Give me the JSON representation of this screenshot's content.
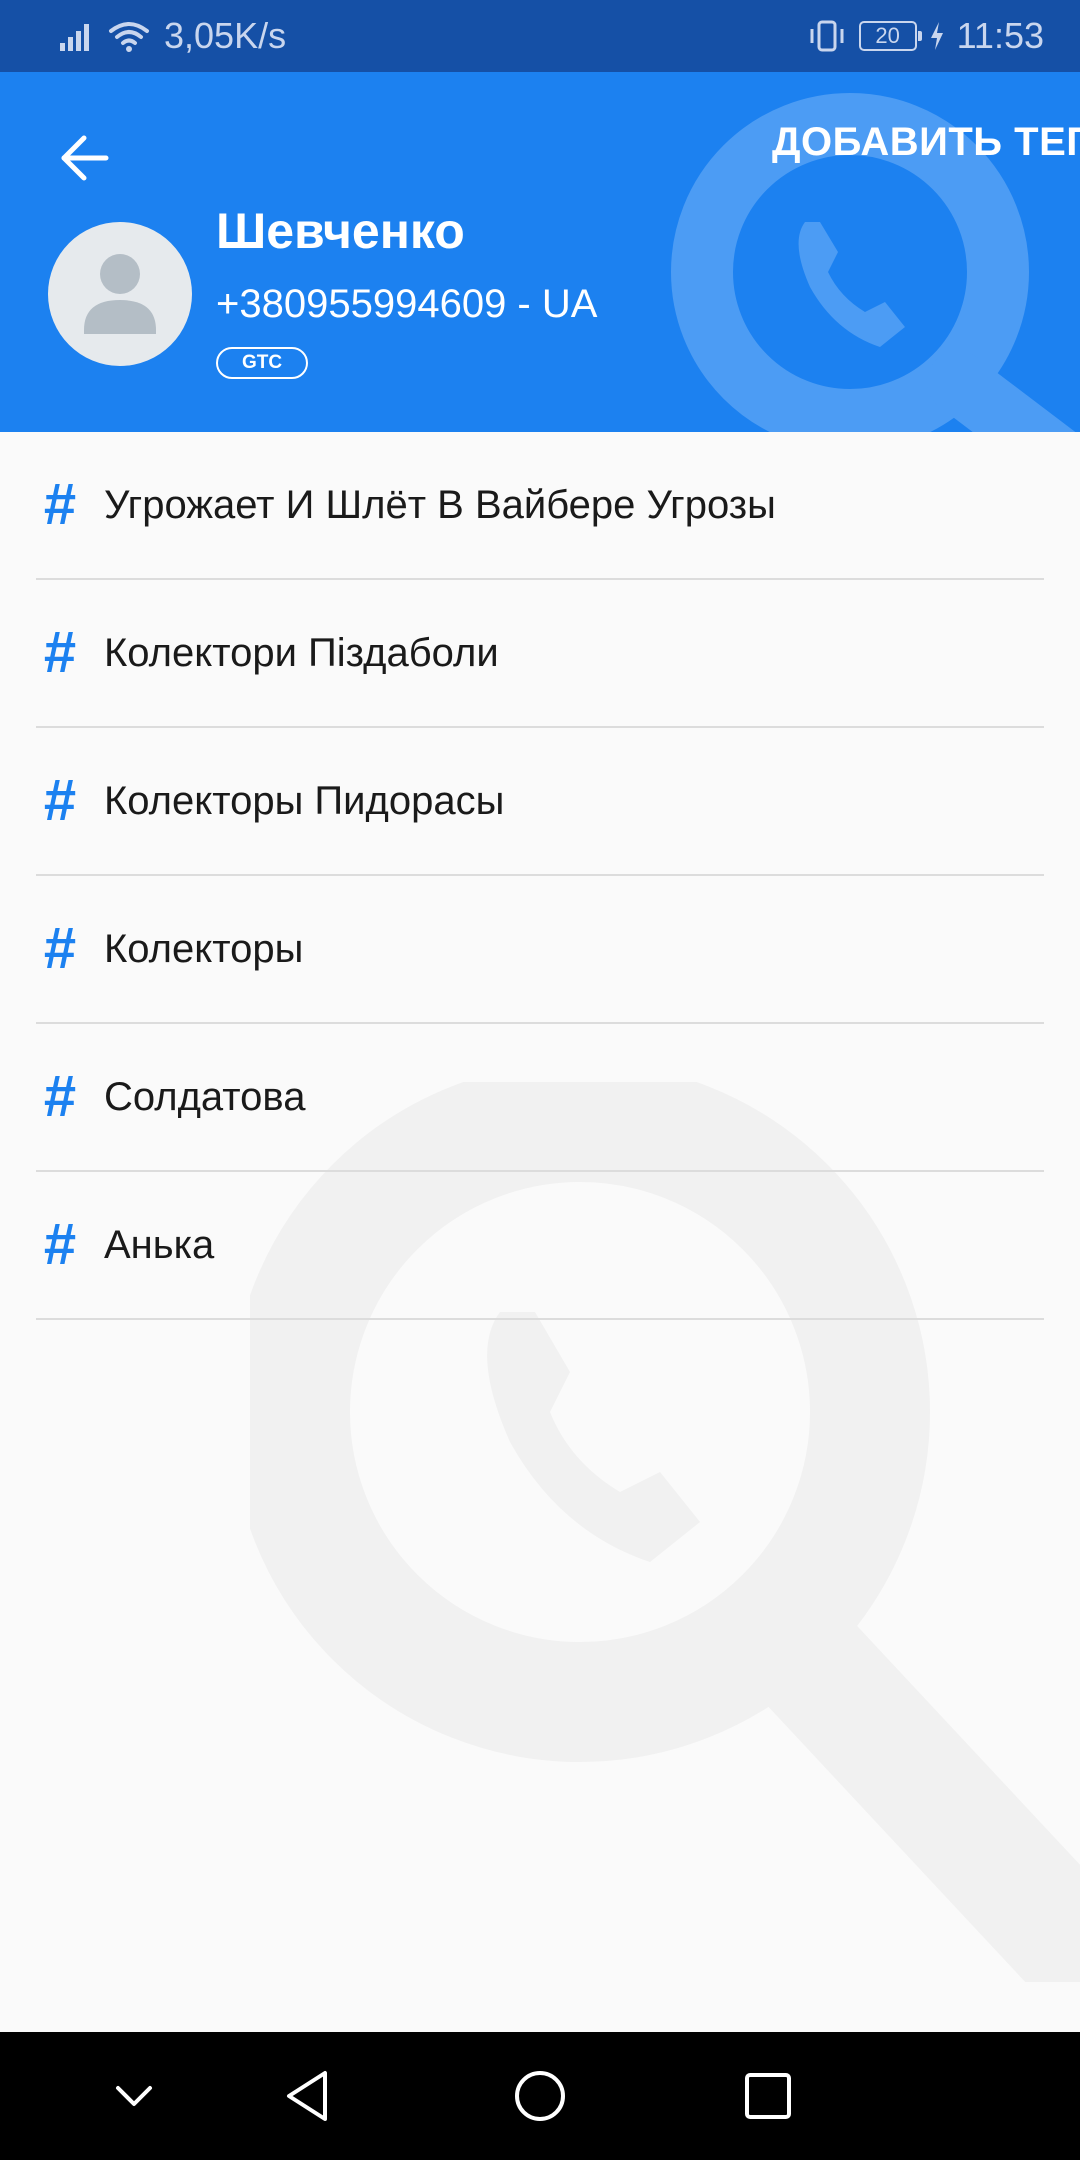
{
  "status_bar": {
    "speed": "3,05K/s",
    "battery": "20",
    "time": "11:53"
  },
  "header": {
    "add_tag_label": "ДОБАВИТЬ ТЕГ",
    "contact_name": "Шевченко",
    "phone": "+380955994609 - UA",
    "carrier": "GTC"
  },
  "tags": [
    {
      "label": "Угрожает И Шлёт В Вайбере Угрозы"
    },
    {
      "label": "Колектори Піздаболи"
    },
    {
      "label": "Колекторы Пидорасы"
    },
    {
      "label": "Колекторы"
    },
    {
      "label": "Солдатова"
    },
    {
      "label": "Анька"
    }
  ],
  "tag_symbol": "#",
  "colors": {
    "status_bar": "#1550a6",
    "header": "#1c81f0",
    "accent": "#1c81f0",
    "background": "#fafafa"
  }
}
